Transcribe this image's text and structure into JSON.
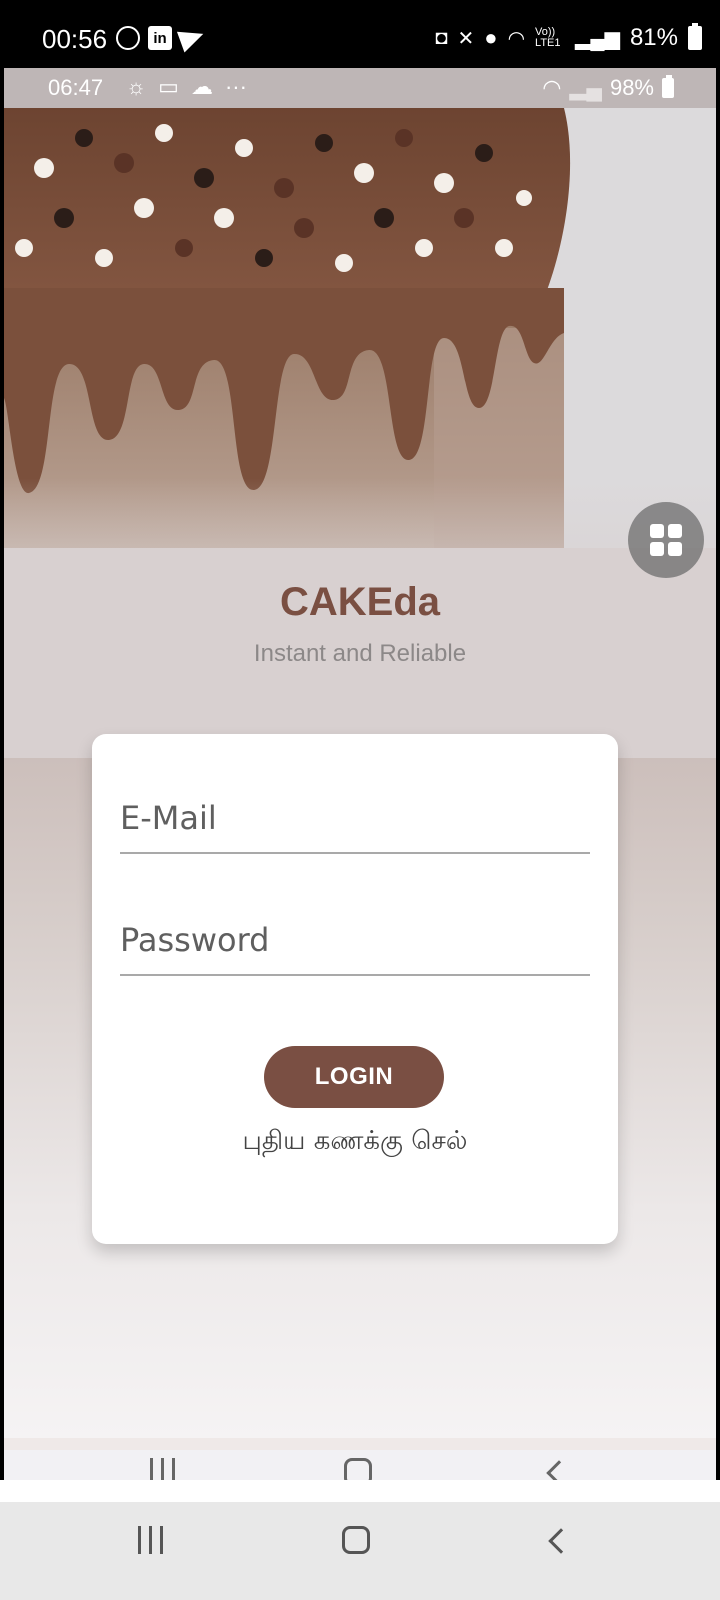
{
  "outer_status": {
    "time": "00:56",
    "battery": "81%",
    "network": "Vo)) LTE1"
  },
  "inner_status": {
    "time": "06:47",
    "more": "···",
    "battery": "98%"
  },
  "app": {
    "title": "CAKEda",
    "subtitle": "Instant and Reliable"
  },
  "login_form": {
    "email_placeholder": "E-Mail",
    "password_placeholder": "Password",
    "login_label": "LOGIN",
    "create_account_label": "புதிய கணக்கு செல்"
  },
  "colors": {
    "brand_brown": "#7a4f43",
    "card_bg": "#ffffff"
  },
  "icons": {
    "floating": "grid-icon",
    "nav_recent": "recent-apps-icon",
    "nav_home": "home-icon",
    "nav_back": "back-icon"
  }
}
